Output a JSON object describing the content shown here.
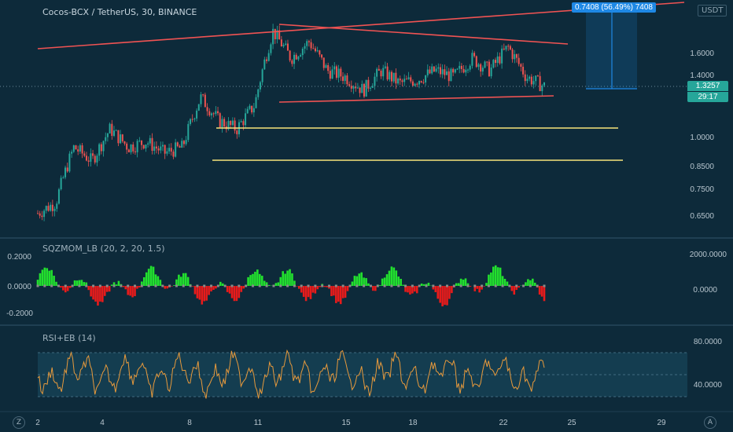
{
  "header": {
    "symbol_title": "Cocos-BCX / TetherUS, 30, BINANCE",
    "currency_button": "USDT",
    "measure_label": "0.7408 (56.49%) 7408",
    "last_price": "1.3257",
    "countdown": "29:17"
  },
  "panes": {
    "squeeze_title": "SQZMOM_LB (20, 2, 20, 1.5)",
    "rsi_title": "RSI+EB (14)"
  },
  "bottom_bar": {
    "left_button": "Z",
    "right_button": "A"
  },
  "colors": {
    "background": "#0d2a3a",
    "up_candle": "#26a69a",
    "down_candle": "#ef5350",
    "trendline": "#f05353",
    "support": "#f7e37a",
    "squeeze_up": "#22e02e",
    "squeeze_down": "#e81b1b",
    "rsi_line": "#e89a3c",
    "measure": "#1e88e5"
  },
  "chart_data": [
    {
      "type": "candlestick",
      "title": "Cocos-BCX / TetherUS, 30, BINANCE",
      "x_ticks": [
        "2",
        "4",
        "8",
        "11",
        "15",
        "18",
        "22",
        "25",
        "29"
      ],
      "y_ticks": [
        1.6,
        1.4,
        1.0,
        0.85,
        0.75,
        0.65
      ],
      "ylim": [
        0.6,
        2.0
      ],
      "scale": "log",
      "last_price": 1.3257,
      "approx_path": [
        0.66,
        0.7,
        0.95,
        0.88,
        1.05,
        0.95,
        0.98,
        0.92,
        0.95,
        1.25,
        1.1,
        1.05,
        1.2,
        1.8,
        1.55,
        1.7,
        1.45,
        1.4,
        1.3,
        1.45,
        1.35,
        1.38,
        1.45,
        1.4,
        1.55,
        1.45,
        1.65,
        1.4,
        1.33
      ]
    },
    {
      "type": "histogram",
      "title": "SQZMOM_LB (20, 2, 20, 1.5)",
      "y_ticks_left": [
        0.2,
        0.0,
        -0.2
      ],
      "y_ticks_right": [
        2000.0,
        0.0
      ]
    },
    {
      "type": "line",
      "title": "RSI+EB (14)",
      "y_ticks": [
        80.0,
        40.0
      ]
    }
  ]
}
